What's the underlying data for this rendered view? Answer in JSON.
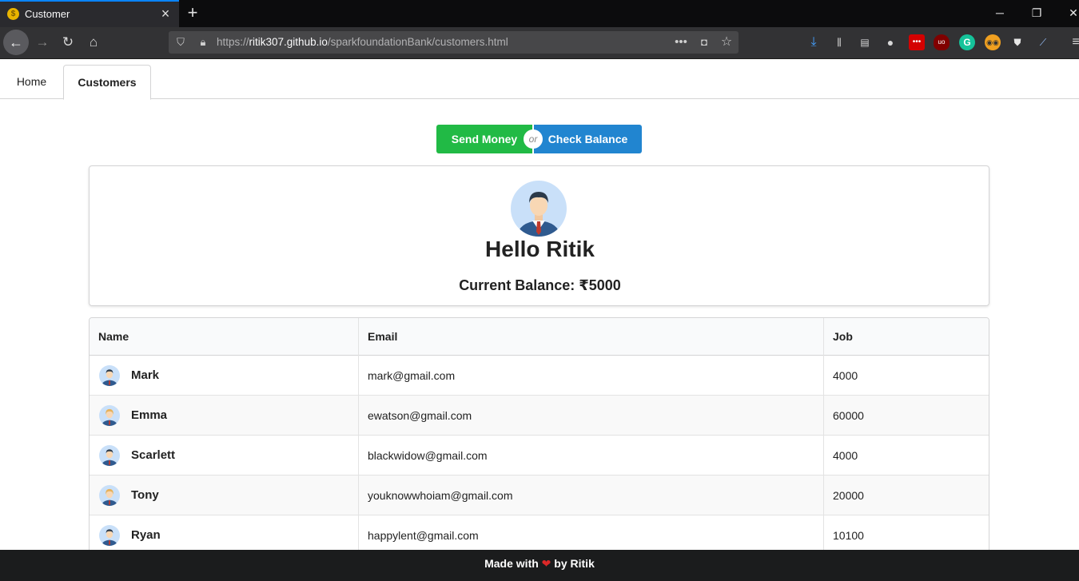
{
  "browser": {
    "tab_title": "Customer",
    "tab_favicon": "$",
    "url_prefix": "https://",
    "url_host": "ritik307.github.io",
    "url_path": "/sparkfoundationBank/customers.html"
  },
  "nav": {
    "tabs": [
      {
        "label": "Home"
      },
      {
        "label": "Customers"
      }
    ]
  },
  "actions": {
    "send_label": "Send Money",
    "or_label": "or",
    "check_label": "Check Balance"
  },
  "profile": {
    "greeting": "Hello Ritik",
    "balance": "Current Balance: ₹5000"
  },
  "table": {
    "headers": [
      "Name",
      "Email",
      "Job"
    ],
    "rows": [
      {
        "name": "Mark",
        "email": "mark@gmail.com",
        "job": "4000",
        "avatar": "male"
      },
      {
        "name": "Emma",
        "email": "ewatson@gmail.com",
        "job": "60000",
        "avatar": "female"
      },
      {
        "name": "Scarlett",
        "email": "blackwidow@gmail.com",
        "job": "4000",
        "avatar": "male"
      },
      {
        "name": "Tony",
        "email": "youknowwhoiam@gmail.com",
        "job": "20000",
        "avatar": "female"
      },
      {
        "name": "Ryan",
        "email": "happylent@gmail.com",
        "job": "10100",
        "avatar": "male"
      }
    ]
  },
  "footer": {
    "prefix": "Made with",
    "heart": "❤",
    "suffix": "by Ritik"
  },
  "colors": {
    "send": "#21ba45",
    "check": "#2185d0",
    "footer_bg": "#1b1c1d",
    "heart": "#db2828"
  }
}
